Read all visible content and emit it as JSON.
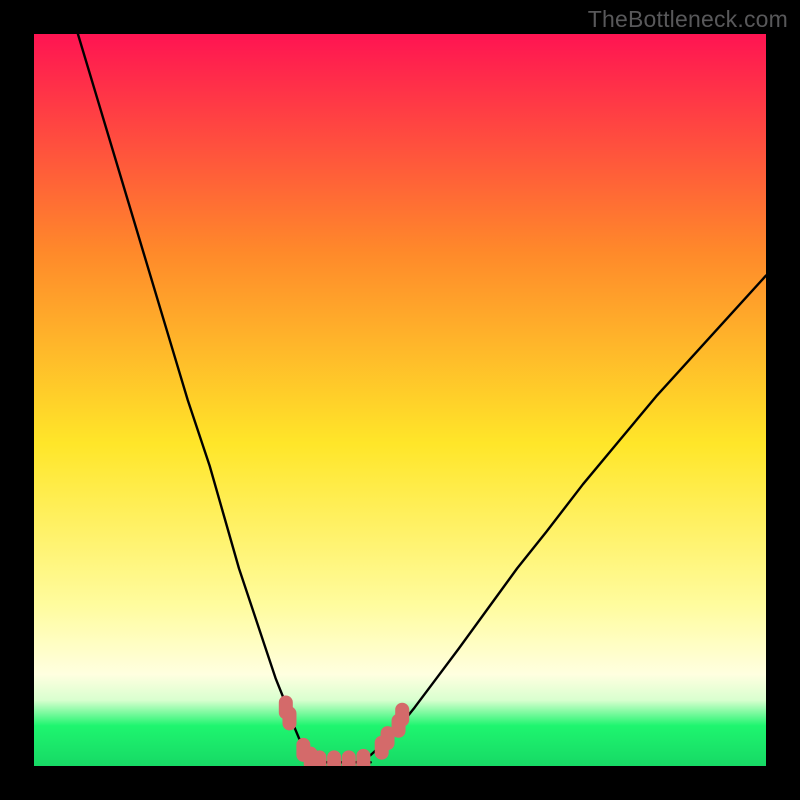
{
  "watermark": "TheBottleneck.com",
  "colors": {
    "black": "#000000",
    "curve": "#000000",
    "marker_fill": "#d46a6a",
    "marker_stroke": "#b85454",
    "grad_top": "#ff1452",
    "grad_mid_upper": "#ff8a2a",
    "grad_mid": "#ffe629",
    "grad_lower_yellow": "#fffc9e",
    "grad_pale": "#ffffe0",
    "grad_green": "#1ef56f",
    "grad_bottom": "#17d965"
  },
  "chart_data": {
    "type": "line",
    "title": "",
    "xlabel": "",
    "ylabel": "",
    "xlim": [
      0,
      100
    ],
    "ylim": [
      0,
      100
    ],
    "grid": false,
    "legend": false,
    "annotations": [],
    "series": [
      {
        "name": "bottleneck-curve-left",
        "x": [
          6,
          9,
          12,
          15,
          18,
          21,
          24,
          26,
          28,
          30,
          31.5,
          33,
          34.2,
          35,
          35.7,
          36.2,
          37,
          38,
          40
        ],
        "y": [
          100,
          90,
          80,
          70,
          60,
          50,
          41,
          34,
          27,
          21,
          16.5,
          12,
          9,
          6.8,
          5,
          3.8,
          2.3,
          1.1,
          0.5
        ]
      },
      {
        "name": "bottleneck-curve-right",
        "x": [
          44,
          46,
          48,
          50,
          52,
          55,
          58,
          62,
          66,
          70,
          75,
          80,
          85,
          90,
          95,
          100
        ],
        "y": [
          0.5,
          1.5,
          3.3,
          5.5,
          8.0,
          12.0,
          16.0,
          21.5,
          27.0,
          32.0,
          38.5,
          44.5,
          50.5,
          56.0,
          61.5,
          67.0
        ]
      }
    ],
    "flat_segment": {
      "name": "bottleneck-floor",
      "x": [
        38,
        46
      ],
      "y": [
        0.5,
        0.5
      ]
    },
    "markers": [
      {
        "x": 34.4,
        "y": 8.0
      },
      {
        "x": 34.9,
        "y": 6.5
      },
      {
        "x": 36.8,
        "y": 2.2
      },
      {
        "x": 37.8,
        "y": 1.0
      },
      {
        "x": 39.0,
        "y": 0.5
      },
      {
        "x": 41.0,
        "y": 0.5
      },
      {
        "x": 43.0,
        "y": 0.5
      },
      {
        "x": 45.0,
        "y": 0.7
      },
      {
        "x": 47.5,
        "y": 2.5
      },
      {
        "x": 48.3,
        "y": 3.8
      },
      {
        "x": 49.8,
        "y": 5.5
      },
      {
        "x": 50.3,
        "y": 7.0
      }
    ]
  }
}
